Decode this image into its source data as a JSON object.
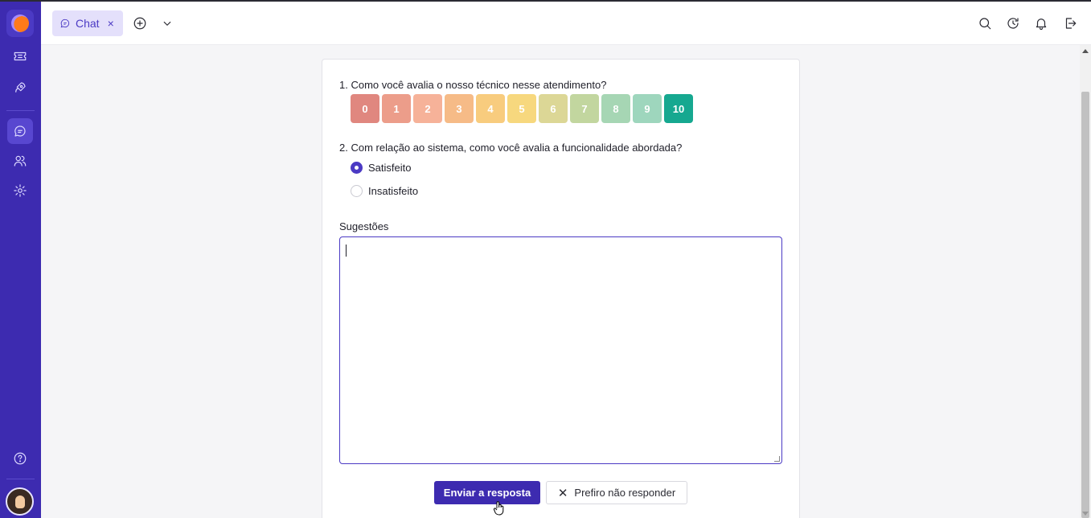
{
  "tabs": [
    {
      "label": "Chat",
      "close": "×"
    }
  ],
  "sidebar": {
    "items": [
      "logo-icon",
      "ticket-icon",
      "rocket-icon",
      "chat-icon",
      "users-icon",
      "gear-icon",
      "help-icon",
      "avatar"
    ],
    "active": "chat-icon"
  },
  "header_icons": [
    "search-icon",
    "history-icon",
    "bell-icon",
    "logout-icon"
  ],
  "survey": {
    "q1": "1. Como você avalia o nosso técnico nesse atendimento?",
    "scale": [
      {
        "label": "0",
        "color": "#e0877f"
      },
      {
        "label": "1",
        "color": "#ec9d8a"
      },
      {
        "label": "2",
        "color": "#f6b299"
      },
      {
        "label": "3",
        "color": "#f6bb87"
      },
      {
        "label": "4",
        "color": "#f8cc7e"
      },
      {
        "label": "5",
        "color": "#f7d87e"
      },
      {
        "label": "6",
        "color": "#dcd796"
      },
      {
        "label": "7",
        "color": "#c2d69f"
      },
      {
        "label": "8",
        "color": "#a6d6b4"
      },
      {
        "label": "9",
        "color": "#9ed6bd"
      },
      {
        "label": "10",
        "color": "#16a890"
      }
    ],
    "selected_score": "10",
    "q2": "2. Com relação ao sistema, como você avalia a funcionalidade abordada?",
    "options": [
      "Satisfeito",
      "Insatisfeito"
    ],
    "selected_option": "Satisfeito",
    "suggestions_label": "Sugestões",
    "suggestions_value": "",
    "submit_label": "Enviar a resposta",
    "skip_label": "Prefiro não responder"
  },
  "colors": {
    "brand": "#3d2bb0",
    "tab_bg": "#e4e0fb"
  }
}
